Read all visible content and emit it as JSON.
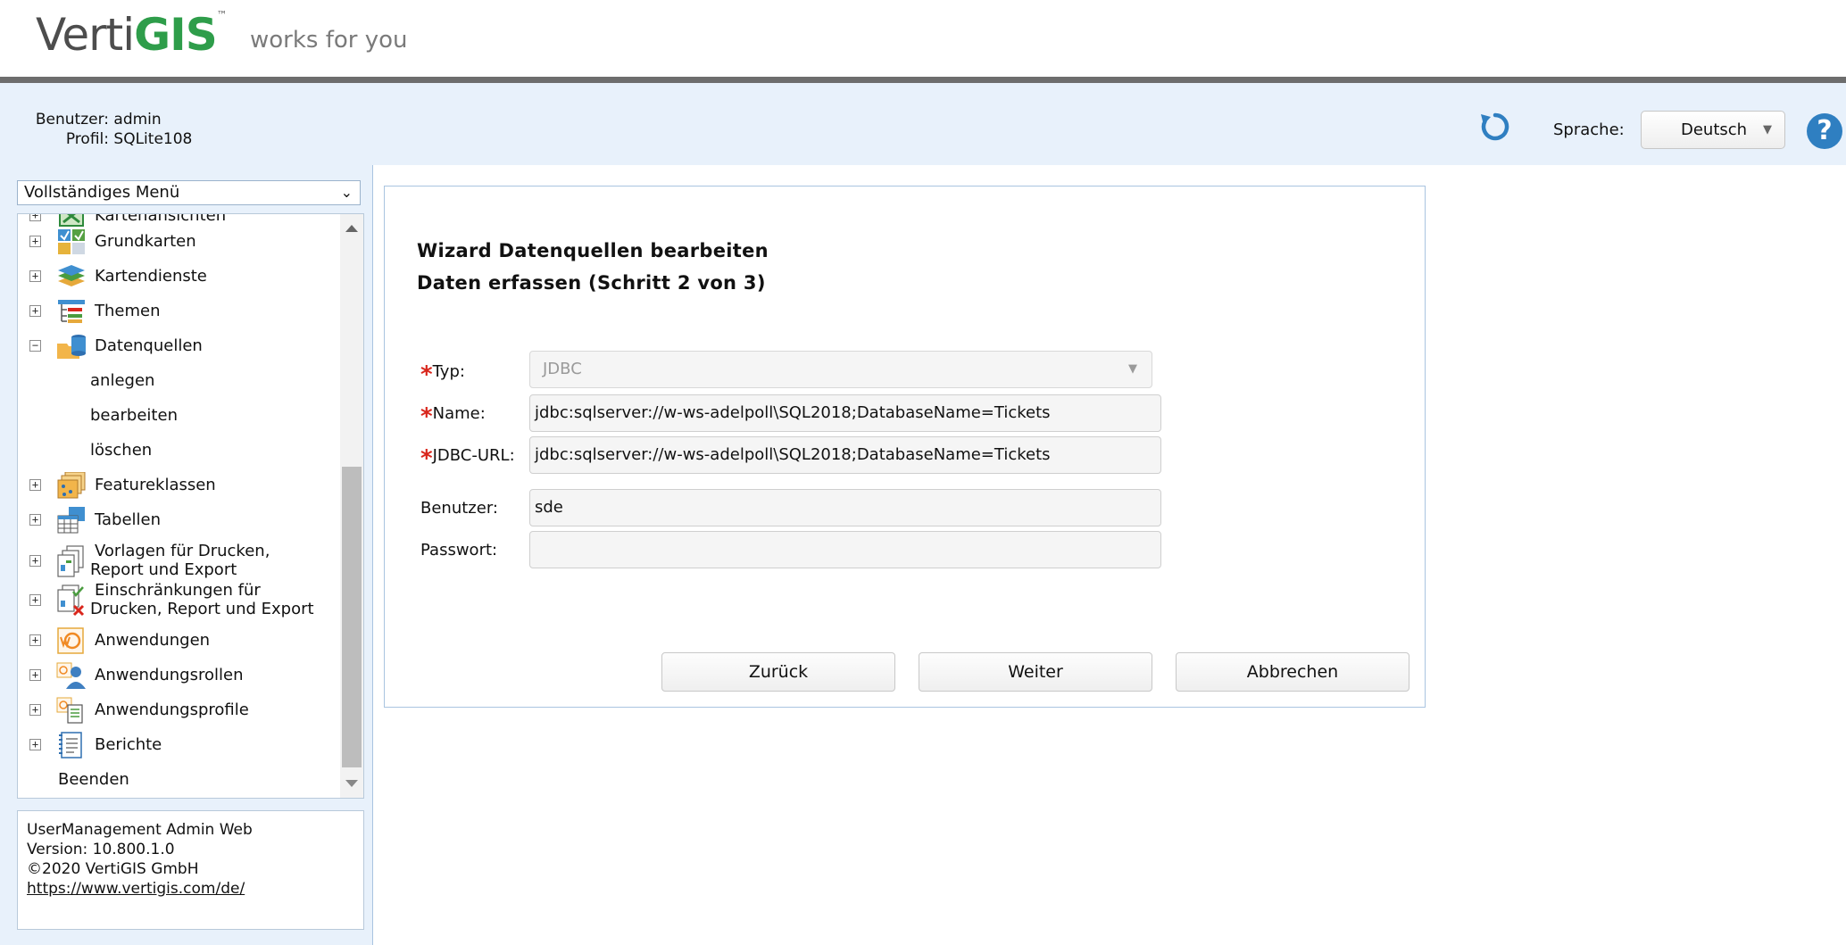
{
  "brand": {
    "logo_main": "Verti",
    "logo_accent": "GIS",
    "logo_mark": "™",
    "slogan": "works for you"
  },
  "userbar": {
    "user_label": "Benutzer:",
    "user_value": "admin",
    "profile_label": "Profil:",
    "profile_value": "SQLite108",
    "language_label": "Sprache:",
    "language_value": "Deutsch",
    "help_symbol": "?",
    "refresh_icon": "refresh-icon",
    "accent_color": "#2f7fc1"
  },
  "sidebar": {
    "menu_select": "Vollständiges Menü",
    "items": [
      {
        "label": "Kartenansichten",
        "expander": "+",
        "icon": "map-views-icon"
      },
      {
        "label": "Grundkarten",
        "expander": "+",
        "icon": "basemaps-icon"
      },
      {
        "label": "Kartendienste",
        "expander": "+",
        "icon": "map-services-icon"
      },
      {
        "label": "Themen",
        "expander": "+",
        "icon": "themes-icon"
      },
      {
        "label": "Datenquellen",
        "expander": "−",
        "icon": "datasources-icon"
      },
      {
        "label": "anlegen"
      },
      {
        "label": "bearbeiten"
      },
      {
        "label": "löschen"
      },
      {
        "label": "Featureklassen",
        "expander": "+",
        "icon": "featureclasses-icon"
      },
      {
        "label": "Tabellen",
        "expander": "+",
        "icon": "tables-icon"
      },
      {
        "label_line1": "Vorlagen für Drucken,",
        "label_line2": "Report und Export",
        "expander": "+",
        "icon": "print-templates-icon"
      },
      {
        "label_line1": "Einschränkungen für",
        "label_line2": "Drucken, Report und Export",
        "expander": "+",
        "icon": "print-restrictions-icon"
      },
      {
        "label": "Anwendungen",
        "expander": "+",
        "icon": "applications-icon"
      },
      {
        "label": "Anwendungsrollen",
        "expander": "+",
        "icon": "application-roles-icon"
      },
      {
        "label": "Anwendungsprofile",
        "expander": "+",
        "icon": "application-profiles-icon"
      },
      {
        "label": "Berichte",
        "expander": "+",
        "icon": "reports-icon"
      },
      {
        "label": "Beenden"
      }
    ],
    "info": {
      "line1": "UserManagement Admin Web",
      "line2": "Version: 10.800.1.0",
      "line3": "©2020 VertiGIS GmbH",
      "link": "https://www.vertigis.com/de/"
    }
  },
  "wizard": {
    "title_line1": "Wizard Datenquellen bearbeiten",
    "title_line2": "Daten erfassen (Schritt 2 von 3)",
    "required_mark": "*",
    "type_label": "Typ:",
    "type_value": "JDBC",
    "name_label": "Name:",
    "name_value": "jdbc:sqlserver://w-ws-adelpoll\\SQL2018;DatabaseName=Tickets",
    "url_label": "JDBC-URL:",
    "url_value": "jdbc:sqlserver://w-ws-adelpoll\\SQL2018;DatabaseName=Tickets",
    "user_label": "Benutzer:",
    "user_value": "sde",
    "password_label": "Passwort:",
    "password_value": "",
    "back_button": "Zurück",
    "next_button": "Weiter",
    "cancel_button": "Abbrechen"
  }
}
